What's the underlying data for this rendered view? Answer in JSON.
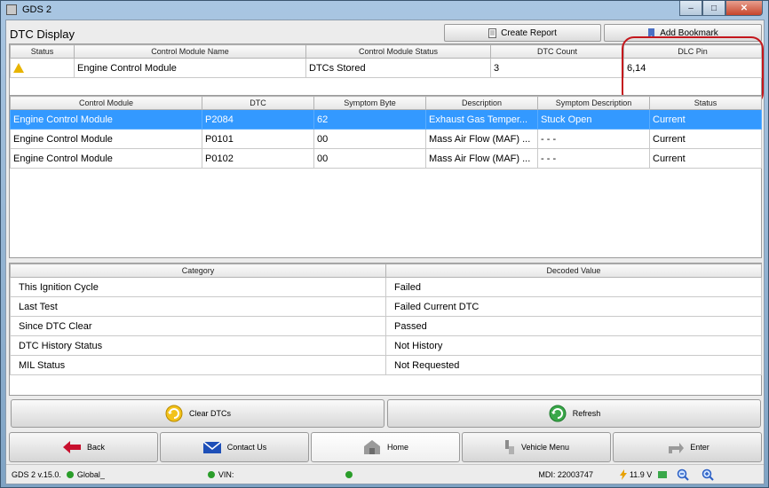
{
  "window": {
    "title": "GDS 2",
    "minimize": "–",
    "maximize": "□",
    "close": "✕"
  },
  "header": {
    "title": "DTC Display",
    "create_report": "Create Report",
    "add_bookmark": "Add Bookmark"
  },
  "summary": {
    "columns": [
      "Status",
      "Control Module Name",
      "Control Module Status",
      "DTC Count",
      "DLC Pin"
    ],
    "rows": [
      {
        "status_icon": "warning-icon",
        "name": "Engine Control Module",
        "module_status": "DTCs Stored",
        "dtc_count": "3",
        "dlc_pin": "6,14"
      }
    ]
  },
  "dtc_table": {
    "columns": [
      "Control Module",
      "DTC",
      "Symptom Byte",
      "Description",
      "Symptom Description",
      "Status"
    ],
    "rows": [
      {
        "module": "Engine Control Module",
        "dtc": "P2084",
        "symptom_byte": "62",
        "description": "Exhaust Gas Temper...",
        "symptom_desc": "Stuck Open",
        "status": "Current",
        "selected": true
      },
      {
        "module": "Engine Control Module",
        "dtc": "P0101",
        "symptom_byte": "00",
        "description": "Mass Air Flow (MAF) ...",
        "symptom_desc": "- - -",
        "status": "Current",
        "selected": false
      },
      {
        "module": "Engine Control Module",
        "dtc": "P0102",
        "symptom_byte": "00",
        "description": "Mass Air Flow (MAF) ...",
        "symptom_desc": "- - -",
        "status": "Current",
        "selected": false
      }
    ]
  },
  "decoded": {
    "columns": [
      "Category",
      "Decoded Value"
    ],
    "rows": [
      {
        "category": "This Ignition Cycle",
        "value": "Failed"
      },
      {
        "category": "Last Test",
        "value": "Failed Current DTC"
      },
      {
        "category": "Since DTC Clear",
        "value": "Passed"
      },
      {
        "category": "DTC History Status",
        "value": "Not History"
      },
      {
        "category": "MIL Status",
        "value": "Not Requested"
      }
    ]
  },
  "actions": {
    "clear_dtcs": "Clear DTCs",
    "refresh": "Refresh"
  },
  "nav": {
    "back": "Back",
    "contact_us": "Contact Us",
    "home": "Home",
    "vehicle_menu": "Vehicle Menu",
    "enter": "Enter"
  },
  "status": {
    "version": "GDS 2 v.15.0.",
    "server": "Global_",
    "vin_label": "VIN:",
    "mdi": "MDI: 22003747",
    "voltage": "11.9 V"
  },
  "colors": {
    "selection": "#3399ff",
    "highlight_ring": "#c4161c",
    "warning": "#e8b400",
    "status_dot": "#2a9d2a"
  }
}
